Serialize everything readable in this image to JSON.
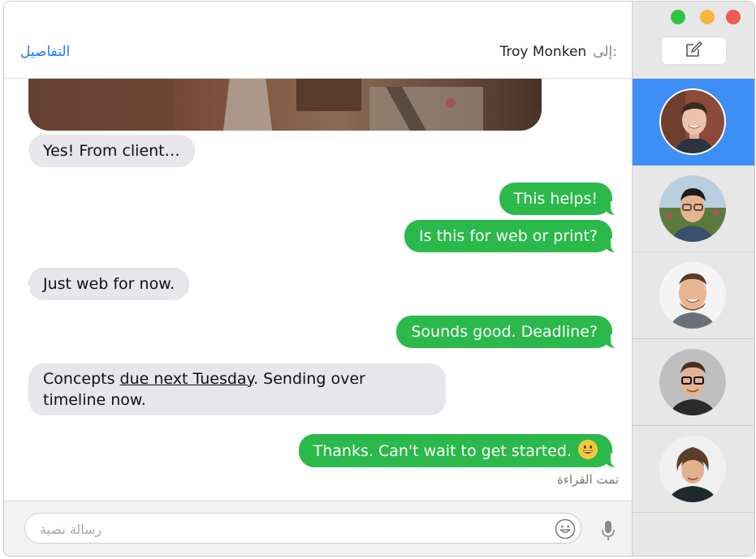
{
  "header": {
    "details_label": "التفاصيل",
    "to_label": "إلى:",
    "recipient": "Troy Monken"
  },
  "messages": [
    {
      "direction": "incoming",
      "text": "Yes! From client…"
    },
    {
      "direction": "outgoing",
      "text": "This helps!"
    },
    {
      "direction": "outgoing",
      "text": "Is this for web or print?"
    },
    {
      "direction": "incoming",
      "text": "Just web for now."
    },
    {
      "direction": "outgoing",
      "text": "Sounds good. Deadline?"
    },
    {
      "direction": "incoming",
      "text_before": "Concepts ",
      "link_text": "due next Tuesday",
      "text_after": ". Sending over timeline now."
    },
    {
      "direction": "outgoing",
      "text": "Thanks. Can't wait to get started.",
      "emoji": "grinning-face"
    }
  ],
  "read_receipt": "تمت القراءة",
  "composer": {
    "placeholder": "رسالة نصية"
  },
  "sidebar": {
    "contacts": [
      {
        "selected": true
      },
      {
        "selected": false
      },
      {
        "selected": false
      },
      {
        "selected": false
      },
      {
        "selected": false
      }
    ]
  },
  "colors": {
    "accent": "#3d8ff5",
    "outgoing_bubble": "#2ab94a",
    "incoming_bubble": "#e6e6eb",
    "link": "#1e7bf0"
  }
}
